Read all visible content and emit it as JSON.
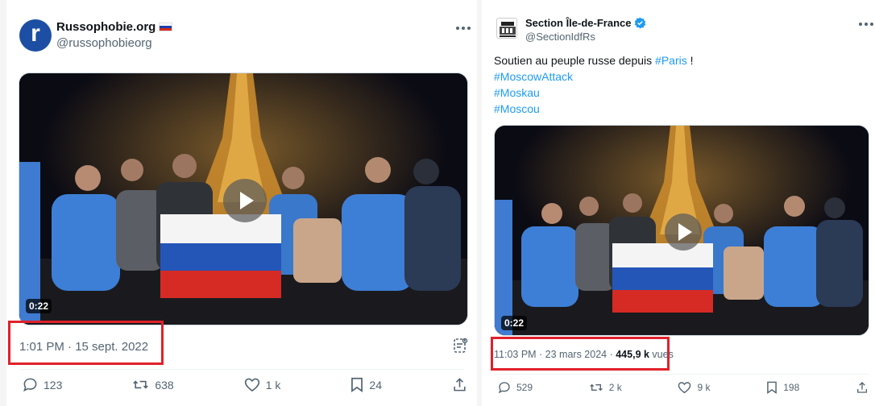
{
  "left_tweet": {
    "author": {
      "display_name": "Russophobie.org",
      "handle": "@russophobieorg",
      "avatar_letter": "r",
      "avatar_color": "#1c4fa3",
      "flag_icon": "russia-flag-icon"
    },
    "video": {
      "duration": "0:22"
    },
    "timestamp": "1:01 PM · 15 sept. 2022",
    "actions": {
      "replies": "123",
      "reposts": "638",
      "likes": "1 k",
      "bookmarks": "24"
    }
  },
  "right_tweet": {
    "author": {
      "display_name": "Section Île-de-France",
      "handle": "@SectionIdfRs",
      "verified_icon": "verified-badge-icon",
      "verified_color": "#1d9bf0"
    },
    "text": {
      "line1_before": "Soutien au peuple russe depuis ",
      "hashtag_paris": "#Paris",
      "line1_after": " !",
      "hashtags": [
        "#MoscowAttack",
        "#Moskau",
        "#Moscou"
      ]
    },
    "video": {
      "duration": "0:22"
    },
    "timestamp": "11:03 PM · 23 mars 2024 · ",
    "views_count": "445,9 k",
    "views_label": " vues",
    "actions": {
      "replies": "529",
      "reposts": "2 k",
      "likes": "9 k",
      "bookmarks": "198"
    }
  },
  "colors": {
    "highlight": "#e0212b",
    "link": "#1d9bf0",
    "secondary_text": "#536471"
  }
}
